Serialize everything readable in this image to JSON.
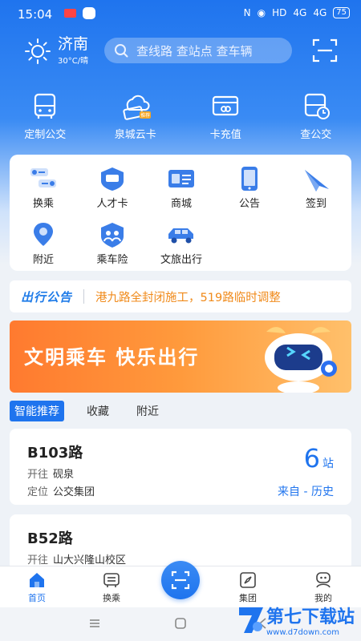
{
  "status": {
    "time": "15:04",
    "net": "HD",
    "signal1": "4G",
    "signal2": "4G",
    "battery": "75"
  },
  "weather": {
    "city": "济南",
    "temp": "30°C/晴"
  },
  "search": {
    "placeholder": "查线路 查站点 查车辆"
  },
  "top_icons": [
    {
      "label": "定制公交",
      "icon": "bus-icon"
    },
    {
      "label": "泉城云卡",
      "icon": "cloud-card-icon",
      "badge": "推荐"
    },
    {
      "label": "卡充值",
      "icon": "card-recharge-icon"
    },
    {
      "label": "查公交",
      "icon": "query-bus-icon"
    }
  ],
  "grid": [
    {
      "label": "换乘",
      "icon": "transfer-icon"
    },
    {
      "label": "人才卡",
      "icon": "talent-card-icon"
    },
    {
      "label": "商城",
      "icon": "mall-icon"
    },
    {
      "label": "公告",
      "icon": "announcement-icon"
    },
    {
      "label": "签到",
      "icon": "checkin-icon"
    },
    {
      "label": "附近",
      "icon": "location-pin-icon"
    },
    {
      "label": "乘车险",
      "icon": "insurance-icon"
    },
    {
      "label": "文旅出行",
      "icon": "tour-car-icon"
    }
  ],
  "notice": {
    "logo": "出行公告",
    "text": "港九路全封闭施工，519路临时调整"
  },
  "banner": {
    "slogan": "文明乘车 快乐出行"
  },
  "tabs": [
    "智能推荐",
    "收藏",
    "附近"
  ],
  "routes": [
    {
      "name": "B103路",
      "dest_label": "开往",
      "dest": "砚泉",
      "loc_label": "定位",
      "loc": "公交集团",
      "stops": "6",
      "stops_unit": "站",
      "source": "来自 - 历史"
    },
    {
      "name": "B52路",
      "dest_label": "开往",
      "dest": "山大兴隆山校区"
    }
  ],
  "tabbar": [
    {
      "label": "首页",
      "icon": "home-icon"
    },
    {
      "label": "换乘",
      "icon": "transfer-tab-icon"
    },
    {
      "label": "集团",
      "icon": "compass-icon"
    },
    {
      "label": "我的",
      "icon": "profile-icon"
    }
  ],
  "watermark": {
    "title": "第七下载站",
    "url": "www.d7down.com"
  },
  "colors": {
    "primary": "#1f74ee",
    "notice": "#f08a1a",
    "banner": "#ff8a35"
  }
}
